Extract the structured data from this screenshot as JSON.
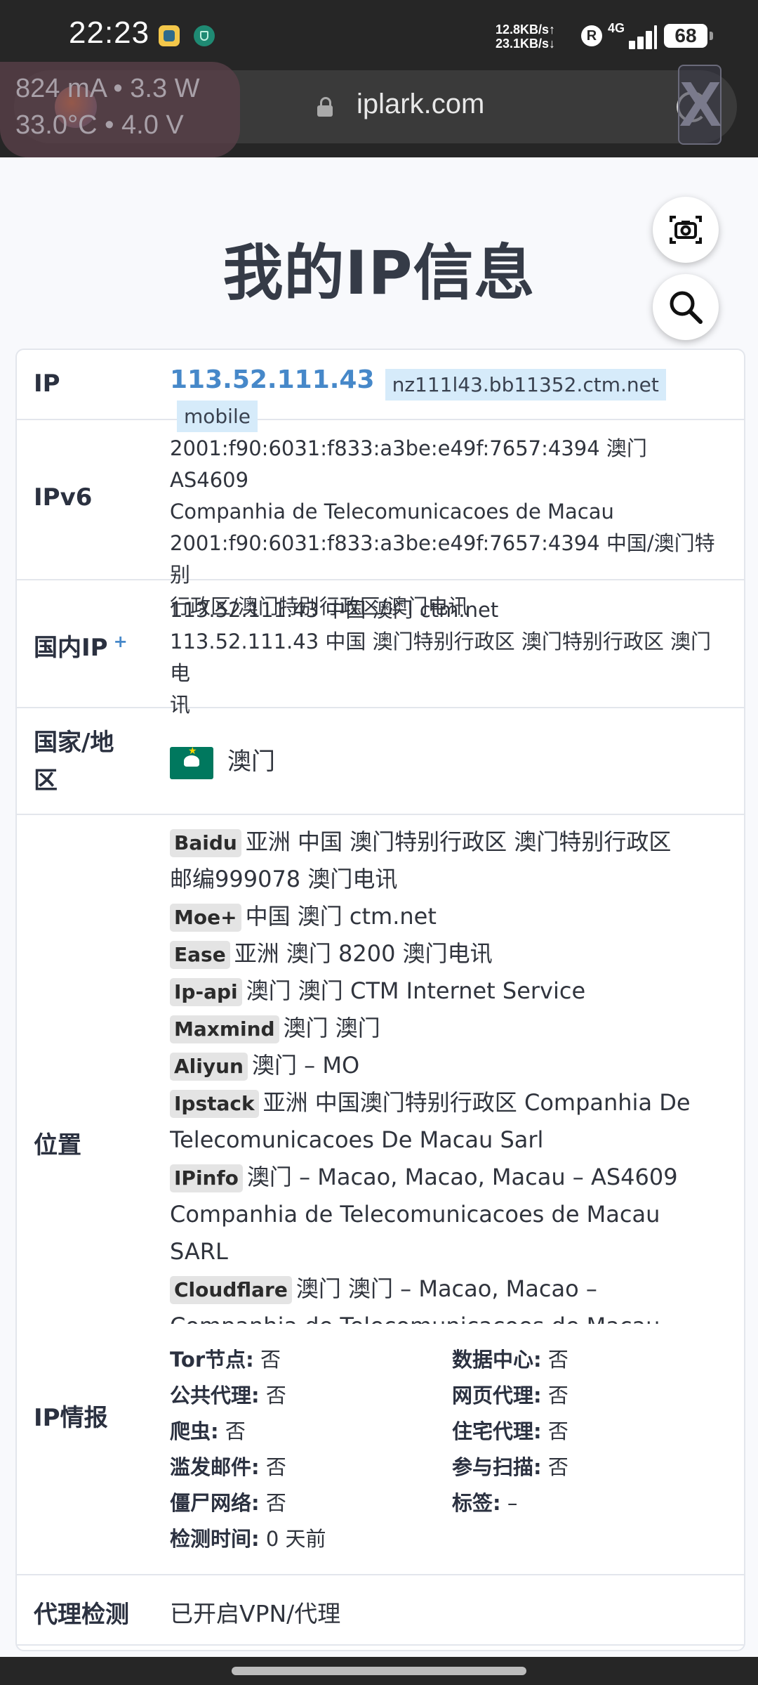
{
  "status_bar": {
    "time": "22:23",
    "net_up": "12.8KB/s↑",
    "net_down": "23.1KB/s↓",
    "r_badge": "R",
    "network_type": "4G",
    "battery": "68"
  },
  "power_overlay": {
    "line1": "824 mA  •  3.3 W",
    "line2": "33.0°C  •  4.0 V"
  },
  "browser": {
    "url": "iplark.com",
    "overlay_letter": "X"
  },
  "page": {
    "title": "我的IP信息"
  },
  "rows": {
    "ip": {
      "label": "IP",
      "address": "113.52.111.43",
      "hostname": "nz111l43.bb11352.ctm.net",
      "type": "mobile"
    },
    "ipv6": {
      "label": "IPv6",
      "lines": [
        "2001:f90:6031:f833:a3be:e49f:7657:4394 澳门 AS4609",
        "Companhia de Telecomunicacoes de Macau",
        "2001:f90:6031:f833:a3be:e49f:7657:4394 中国/澳门特别",
        "行政区/澳门特别行政区/澳门电讯"
      ]
    },
    "domestic": {
      "label": "国内IP",
      "plus": "+",
      "lines": [
        "113.52.111.43 中国 澳门 ctm.net",
        "113.52.111.43 中国 澳门特别行政区 澳门特别行政区 澳门电",
        "讯"
      ]
    },
    "country": {
      "label_line1": "国家/地",
      "label_line2": "区",
      "name": "澳门"
    },
    "location": {
      "label": "位置",
      "sources": [
        {
          "badge": "Baidu",
          "text": "亚洲 中国 澳门特别行政区 澳门特别行政区",
          "cont": "邮编999078 澳门电讯"
        },
        {
          "badge": "Moe+",
          "text": "中国 澳门 ctm.net"
        },
        {
          "badge": "Ease",
          "text": "亚洲 澳门 8200 澳门电讯"
        },
        {
          "badge": "Ip-api",
          "text": "澳门 澳门 CTM Internet Service"
        },
        {
          "badge": "Maxmind",
          "text": "澳门 澳门"
        },
        {
          "badge": "Aliyun",
          "text": "澳门 – MO"
        },
        {
          "badge": "Ipstack",
          "text": "亚洲 中国澳门特别行政区 Companhia De",
          "cont": "Telecomunicacoes De Macau Sarl"
        },
        {
          "badge": "IPinfo",
          "text": "澳门 – Macao, Macao, Macau – AS4609",
          "cont": "Companhia de Telecomunicacoes de Macau",
          "cont2": "SARL"
        },
        {
          "badge": "Cloudflare",
          "text": "澳门 澳门 – Macao, Macao –",
          "cont": "Companhia de Telecomunicacoes de Macau"
        }
      ]
    },
    "intel": {
      "label": "IP情报",
      "items": [
        {
          "k": "Tor节点:",
          "v": "否"
        },
        {
          "k": "数据中心:",
          "v": "否"
        },
        {
          "k": "公共代理:",
          "v": "否"
        },
        {
          "k": "网页代理:",
          "v": "否"
        },
        {
          "k": "爬虫:",
          "v": "否"
        },
        {
          "k": "住宅代理:",
          "v": "否"
        },
        {
          "k": "滥发邮件:",
          "v": "否"
        },
        {
          "k": "参与扫描:",
          "v": "否"
        },
        {
          "k": "僵尸网络:",
          "v": "否"
        },
        {
          "k": "标签:",
          "v": "–"
        },
        {
          "k": "检测时间:",
          "v": "0 天前"
        }
      ]
    },
    "proxy": {
      "label": "代理检测",
      "value": "已开启VPN/代理"
    }
  }
}
